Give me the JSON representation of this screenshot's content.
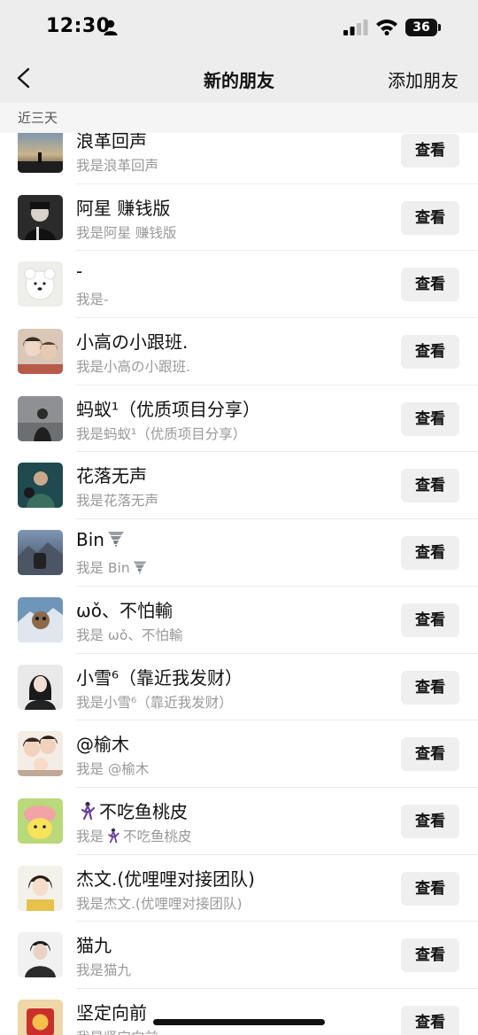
{
  "status_bar": {
    "time": "12:30",
    "battery": "36",
    "icons": [
      "person-icon",
      "signal-icon",
      "wifi-icon",
      "battery-icon"
    ]
  },
  "nav": {
    "back_icon": "chevron-left-icon",
    "title": "新的朋友",
    "action": "添加朋友"
  },
  "section": {
    "label": "近三天"
  },
  "colors": {
    "header_bg": "#ededed",
    "section_bg": "#f5f5f5",
    "button_bg": "#efefef",
    "subtitle": "#999999"
  },
  "friends": [
    {
      "name": "浪革回声",
      "sub": "我是浪革回声",
      "button": "查看"
    },
    {
      "name": "阿星 赚钱版",
      "sub": "我是阿星 赚钱版",
      "button": "查看"
    },
    {
      "name": "-",
      "sub": "我是-",
      "button": "查看"
    },
    {
      "name": "小高の小跟班.",
      "sub": "我是小高の小跟班.",
      "button": "查看"
    },
    {
      "name": "蚂蚁¹（优质项目分享）",
      "sub": "我是蚂蚁¹（优质项目分享）",
      "button": "查看"
    },
    {
      "name": "花落无声",
      "sub": "我是花落无声",
      "button": "查看"
    },
    {
      "name": "Bin",
      "sub": "我是 Bin",
      "button": "查看",
      "emoji": "tornado-icon"
    },
    {
      "name": "ωǒ、不怕輸",
      "sub": "我是 ωǒ、不怕輸",
      "button": "查看"
    },
    {
      "name": "小雪⁶（靠近我发财）",
      "sub": "我是小雪⁶（靠近我发财）",
      "button": "查看"
    },
    {
      "name": "@榆木",
      "sub": "我是 @榆木",
      "button": "查看"
    },
    {
      "name": "不吃鱼桃皮",
      "sub": "不吃鱼桃皮",
      "sub_prefix": "我是",
      "button": "查看",
      "emoji": "dancer-icon"
    },
    {
      "name": "杰文.(优哩哩对接团队)",
      "sub": "我是杰文.(优哩哩对接团队)",
      "button": "查看"
    },
    {
      "name": "猫九",
      "sub": "我是猫九",
      "button": "查看"
    },
    {
      "name": "坚定向前",
      "sub": "我是坚定向前",
      "button": "查看"
    }
  ]
}
